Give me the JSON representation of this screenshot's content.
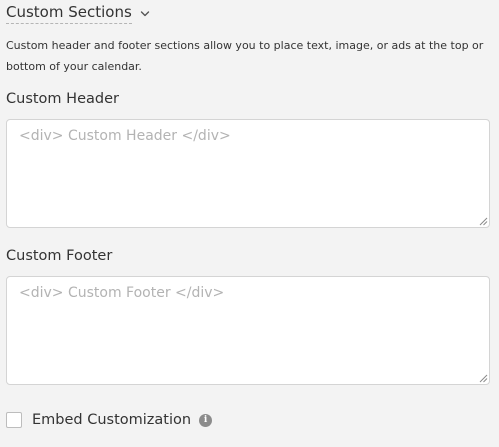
{
  "section": {
    "title": "Custom Sections",
    "chevron_icon": "chevron-down-icon",
    "description": "Custom header and footer sections allow you to place text, image, or ads at the top or bottom of your calendar."
  },
  "header_field": {
    "label": "Custom Header",
    "placeholder": "<div> Custom Header </div>",
    "value": ""
  },
  "footer_field": {
    "label": "Custom Footer",
    "placeholder": "<div> Custom Footer </div>",
    "value": ""
  },
  "embed": {
    "label": "Embed Customization",
    "checked": false,
    "info_icon": "info-icon"
  },
  "colors": {
    "background": "#f3f3f3",
    "text": "#333333",
    "placeholder": "#b3b3b3",
    "border": "#d4d4d4",
    "info_icon": "#8c8c8c"
  }
}
